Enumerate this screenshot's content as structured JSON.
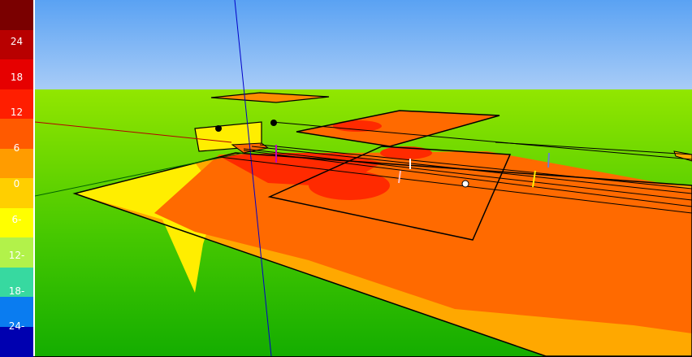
{
  "legend": {
    "colors": [
      "#7a0000",
      "#b80000",
      "#e60000",
      "#ff1e00",
      "#ff5a00",
      "#ff9c00",
      "#ffcf00",
      "#ffff00",
      "#b2f24a",
      "#37d9a0",
      "#0a7cf0",
      "#0000b0"
    ],
    "labels": [
      "24",
      "18",
      "12",
      "6",
      "0",
      "6-",
      "12-",
      "18-",
      "24-"
    ]
  },
  "scene": {
    "sky_top": "#5aa2f3",
    "sky_bottom": "#a8ccf7",
    "ground": "#7fe000",
    "ground_dark": "#1ab400"
  }
}
